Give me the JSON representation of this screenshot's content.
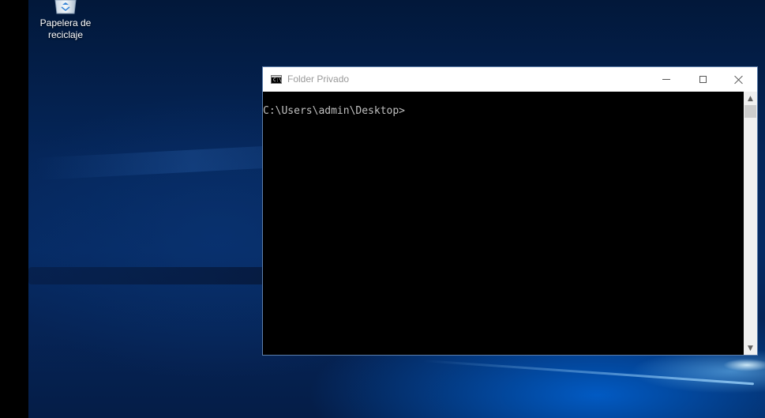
{
  "desktop": {
    "recycle_bin": {
      "label": "Papelera de\nreciclaje",
      "icon": "recycle-bin-icon"
    }
  },
  "console": {
    "title": "Folder Privado",
    "app_icon": "console-icon",
    "app_icon_text": "C:\\",
    "prompt": "C:\\Users\\admin\\Desktop>",
    "controls": {
      "minimize": "minimize-icon",
      "maximize": "maximize-icon",
      "close": "close-icon"
    },
    "scrollbar": {
      "up": "▲",
      "down": "▼"
    }
  },
  "colors": {
    "desktop_blue": "#062a63",
    "console_bg": "#000000",
    "console_text": "#c0c0c0",
    "title_text": "#999999"
  }
}
